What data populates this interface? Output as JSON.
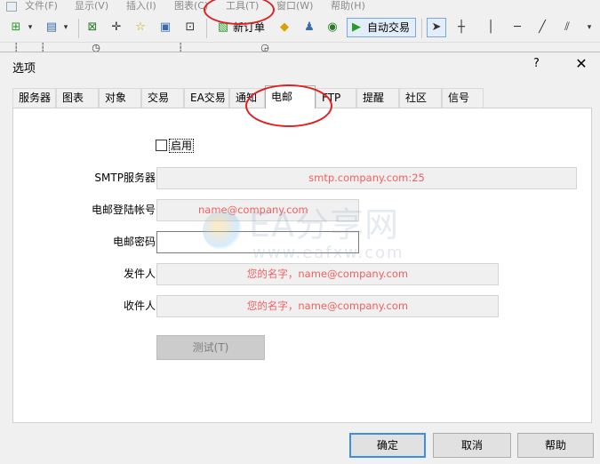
{
  "menubar": {
    "items": [
      "文件(F)",
      "显示(V)",
      "插入(I)",
      "图表(C)",
      "工具(T)",
      "窗口(W)",
      "帮助(H)"
    ]
  },
  "toolbar": {
    "new_order_label": "新订单",
    "auto_trade_label": "自动交易",
    "icons": [
      "new-chart-icon",
      "profiles-icon",
      "zoom-in-icon",
      "crosshair-icon",
      "favorites-icon",
      "navigator-icon",
      "terminal-icon",
      "new-order-icon",
      "meta-editor-icon",
      "market-icon",
      "signals-icon",
      "auto-trade-icon",
      "cursor-icon",
      "crosshair-tool-icon",
      "vertical-line-icon",
      "horizontal-line-icon",
      "trendline-icon",
      "fibonacci-icon"
    ]
  },
  "dialog": {
    "title": "选项",
    "help_glyph": "?",
    "close_glyph": "✕",
    "tabs": [
      "服务器",
      "图表",
      "对象",
      "交易",
      "EA交易",
      "通知",
      "电邮",
      "FTP",
      "提醒",
      "社区",
      "信号"
    ],
    "active_tab": "电邮",
    "enable_label": "启用",
    "enable_checked": false,
    "fields": {
      "smtp_label": "SMTP服务器:",
      "smtp_value": "smtp.company.com:25",
      "login_label": "电邮登陆帐号:",
      "login_value": "name@company.com",
      "password_label": "电邮密码:",
      "password_value": "",
      "from_label": "发件人:",
      "from_value": "您的名字，name@company.com",
      "to_label": "收件人:",
      "to_value": "您的名字，name@company.com"
    },
    "test_button": "测试(T)",
    "ok_button": "确定",
    "cancel_button": "取消",
    "help_button": "帮助"
  },
  "watermark": {
    "text": "EA分享网",
    "url": "www.eafxw.com"
  },
  "colors": {
    "annotation": "#e02020",
    "field_text": "#f06060",
    "default_button_border": "#3c8ee0"
  }
}
